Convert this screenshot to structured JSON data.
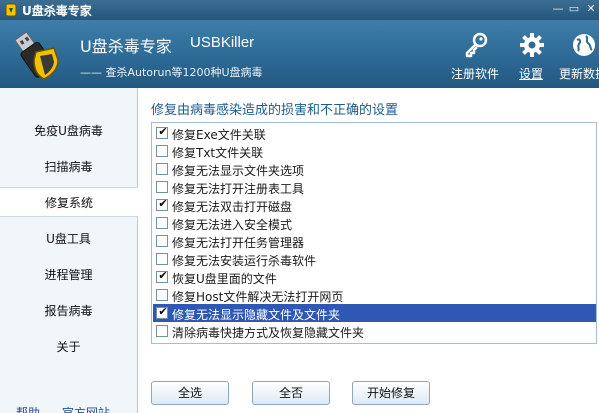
{
  "window": {
    "title": "U盘杀毒专家",
    "controls": {
      "minimize": "—",
      "restore": "▭",
      "close": "✕"
    }
  },
  "header": {
    "brand_cn": "U盘杀毒专家",
    "brand_en": "USBKiller",
    "tagline": "—— 查杀Autorun等1200种U盘病毒",
    "buttons": [
      {
        "label": "注册软件",
        "icon": "key-icon"
      },
      {
        "label": "设置",
        "icon": "gear-icon",
        "active": true
      },
      {
        "label": "更新数据",
        "icon": "globe-icon"
      }
    ]
  },
  "sidebar": {
    "items": [
      {
        "label": "免疫U盘病毒"
      },
      {
        "label": "扫描病毒"
      },
      {
        "label": "修复系统",
        "active": true
      },
      {
        "label": "U盘工具"
      },
      {
        "label": "进程管理"
      },
      {
        "label": "报告病毒"
      },
      {
        "label": "关于"
      }
    ],
    "footer": {
      "help": "帮助",
      "website": "官方网站"
    }
  },
  "main": {
    "title": "修复由病毒感染造成的损害和不正确的设置",
    "options": [
      {
        "label": "修复Exe文件关联",
        "checked": true
      },
      {
        "label": "修复Txt文件关联",
        "checked": false
      },
      {
        "label": "修复无法显示文件夹选项",
        "checked": false
      },
      {
        "label": "修复无法打开注册表工具",
        "checked": false
      },
      {
        "label": "修复无法双击打开磁盘",
        "checked": true
      },
      {
        "label": "修复无法进入安全模式",
        "checked": false
      },
      {
        "label": "修复无法打开任务管理器",
        "checked": false
      },
      {
        "label": "修复无法安装运行杀毒软件",
        "checked": false
      },
      {
        "label": "恢复U盘里面的文件",
        "checked": true
      },
      {
        "label": "修复Host文件解决无法打开网页",
        "checked": false
      },
      {
        "label": "修复无法显示隐藏文件及文件夹",
        "checked": true,
        "selected": true
      },
      {
        "label": "清除病毒快捷方式及恢复隐藏文件夹",
        "checked": false
      }
    ],
    "buttons": {
      "select_all": "全选",
      "select_none": "全否",
      "start_repair": "开始修复"
    }
  },
  "colors": {
    "header": "#2d6a96",
    "selection": "#2f58b5",
    "sidebar": "#f1f6fb",
    "title_text": "#1d5b8c"
  }
}
